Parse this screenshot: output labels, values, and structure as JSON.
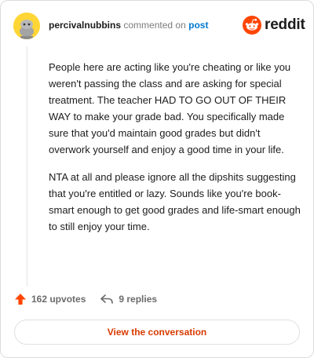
{
  "header": {
    "username": "percivalnubbins",
    "commented_text": "commented on",
    "post_link": "post"
  },
  "brand": {
    "wordmark": "reddit",
    "color": "#ff4500"
  },
  "comment": {
    "paragraphs": [
      "People here are acting like you're cheating or like you weren't passing the class and are asking for special treatment. The teacher HAD TO GO OUT OF THEIR WAY to make your grade bad. You specifically made sure that you'd maintain good grades but didn't overwork yourself and enjoy a good time in your life.",
      "NTA at all and please ignore all the dipshits suggesting that you're entitled or lazy. Sounds like you're book-smart enough to get good grades and life-smart enough to still enjoy your time."
    ]
  },
  "actions": {
    "upvotes": "162 upvotes",
    "replies": "9 replies",
    "upvote_color": "#ff4500"
  },
  "cta": {
    "label": "View the conversation",
    "color": "#d93a00"
  },
  "icons": {
    "avatar": "snoo-avatar-icon",
    "logo": "reddit-snoo-icon",
    "upvote": "upvote-arrow-icon",
    "reply": "reply-arrow-icon"
  }
}
